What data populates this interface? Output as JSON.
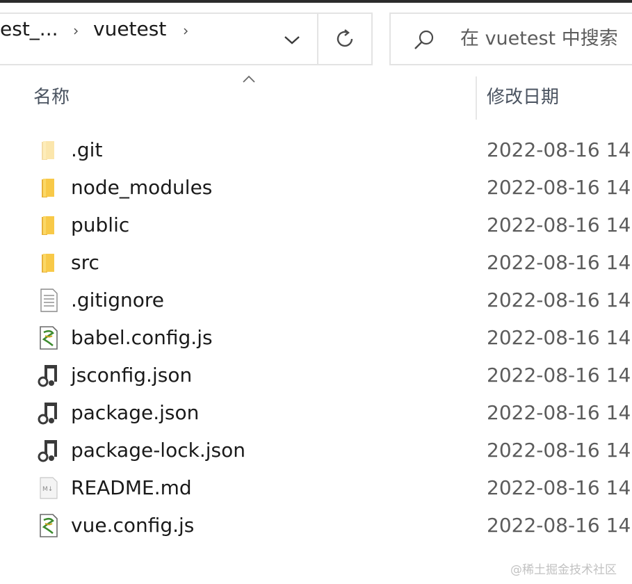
{
  "address_bar": {
    "crumbs": [
      "est_...",
      "vuetest"
    ],
    "dropdown_icon": "chevron-down-icon",
    "separator_icon": "chevron-right-icon"
  },
  "refresh": {
    "icon": "refresh-icon"
  },
  "search": {
    "icon": "search-icon",
    "placeholder": "在 vuetest 中搜索"
  },
  "columns": {
    "name": "名称",
    "modified": "修改日期",
    "sort_icon": "sort-up-icon"
  },
  "files": [
    {
      "name": ".git",
      "date": "2022-08-16 14",
      "icon": "folder-icon",
      "kind": "folder-faded"
    },
    {
      "name": "node_modules",
      "date": "2022-08-16 14",
      "icon": "folder-icon",
      "kind": "folder"
    },
    {
      "name": "public",
      "date": "2022-08-16 14",
      "icon": "folder-icon",
      "kind": "folder"
    },
    {
      "name": "src",
      "date": "2022-08-16 14",
      "icon": "folder-icon",
      "kind": "folder"
    },
    {
      "name": ".gitignore",
      "date": "2022-08-16 14",
      "icon": "text-file-icon",
      "kind": "text"
    },
    {
      "name": "babel.config.js",
      "date": "2022-08-16 14",
      "icon": "js-file-icon",
      "kind": "js"
    },
    {
      "name": "jsconfig.json",
      "date": "2022-08-16 14",
      "icon": "json-file-icon",
      "kind": "json"
    },
    {
      "name": "package.json",
      "date": "2022-08-16 14",
      "icon": "json-file-icon",
      "kind": "json"
    },
    {
      "name": "package-lock.json",
      "date": "2022-08-16 14",
      "icon": "json-file-icon",
      "kind": "json"
    },
    {
      "name": "README.md",
      "date": "2022-08-16 14",
      "icon": "markdown-file-icon",
      "kind": "md"
    },
    {
      "name": "vue.config.js",
      "date": "2022-08-16 14",
      "icon": "js-file-icon",
      "kind": "js"
    }
  ],
  "watermark": "@稀土掘金技术社区",
  "colors": {
    "folder": "#f8c948",
    "folder_dark": "#e8b23a",
    "border": "#e3e3e3",
    "header_text": "#4a5360",
    "date_text": "#5c5c5c"
  }
}
